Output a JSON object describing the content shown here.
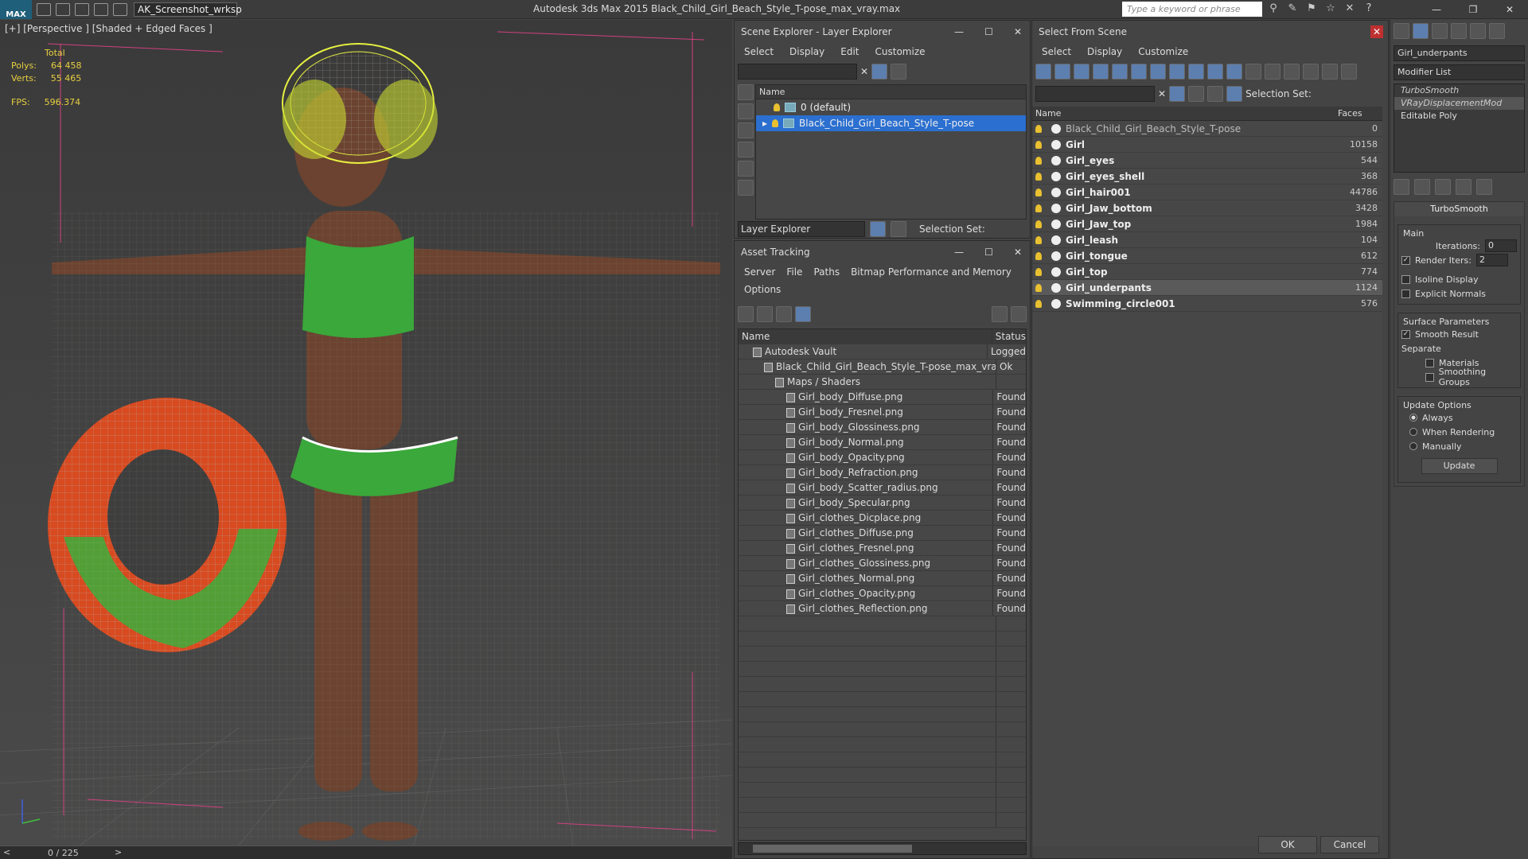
{
  "titlebar": {
    "logo": "MAX",
    "workspace": "AK_Screenshot_wrksp",
    "app_title": "Autodesk 3ds Max  2015    Black_Child_Girl_Beach_Style_T-pose_max_vray.max",
    "search_placeholder": "Type a keyword or phrase"
  },
  "viewport": {
    "label": "[+] [Perspective ] [Shaded + Edged Faces ]",
    "stats_total": "Total",
    "polys_label": "Polys:",
    "polys_value": "64 458",
    "verts_label": "Verts:",
    "verts_value": "55 465",
    "fps_label": "FPS:",
    "fps_value": "596.374"
  },
  "timeline": {
    "frame": "0 / 225"
  },
  "scene_explorer": {
    "title": "Scene Explorer - Layer Explorer",
    "menu": [
      "Select",
      "Display",
      "Edit",
      "Customize"
    ],
    "col_name": "Name",
    "layers": [
      "0 (default)",
      "Black_Child_Girl_Beach_Style_T-pose"
    ],
    "footer_label": "Layer Explorer",
    "selection_set": "Selection Set:"
  },
  "asset_tracking": {
    "title": "Asset Tracking",
    "menu": [
      "Server",
      "File",
      "Paths",
      "Bitmap Performance and Memory"
    ],
    "menu2": "Options",
    "col_name": "Name",
    "col_status": "Status",
    "rows": [
      {
        "name": "Autodesk Vault",
        "status": "Logged",
        "indent": 0
      },
      {
        "name": "Black_Child_Girl_Beach_Style_T-pose_max_vray....",
        "status": "Ok",
        "indent": 1
      },
      {
        "name": "Maps / Shaders",
        "status": "",
        "indent": 2
      },
      {
        "name": "Girl_body_Diffuse.png",
        "status": "Found",
        "indent": 3
      },
      {
        "name": "Girl_body_Fresnel.png",
        "status": "Found",
        "indent": 3
      },
      {
        "name": "Girl_body_Glossiness.png",
        "status": "Found",
        "indent": 3
      },
      {
        "name": "Girl_body_Normal.png",
        "status": "Found",
        "indent": 3
      },
      {
        "name": "Girl_body_Opacity.png",
        "status": "Found",
        "indent": 3
      },
      {
        "name": "Girl_body_Refraction.png",
        "status": "Found",
        "indent": 3
      },
      {
        "name": "Girl_body_Scatter_radius.png",
        "status": "Found",
        "indent": 3
      },
      {
        "name": "Girl_body_Specular.png",
        "status": "Found",
        "indent": 3
      },
      {
        "name": "Girl_clothes_Dicplace.png",
        "status": "Found",
        "indent": 3
      },
      {
        "name": "Girl_clothes_Diffuse.png",
        "status": "Found",
        "indent": 3
      },
      {
        "name": "Girl_clothes_Fresnel.png",
        "status": "Found",
        "indent": 3
      },
      {
        "name": "Girl_clothes_Glossiness.png",
        "status": "Found",
        "indent": 3
      },
      {
        "name": "Girl_clothes_Normal.png",
        "status": "Found",
        "indent": 3
      },
      {
        "name": "Girl_clothes_Opacity.png",
        "status": "Found",
        "indent": 3
      },
      {
        "name": "Girl_clothes_Reflection.png",
        "status": "Found",
        "indent": 3
      }
    ]
  },
  "select_from_scene": {
    "title": "Select From Scene",
    "menu": [
      "Select",
      "Display",
      "Customize"
    ],
    "selection_set": "Selection Set:",
    "col_name": "Name",
    "col_faces": "Faces",
    "rows": [
      {
        "name": "Black_Child_Girl_Beach_Style_T-pose",
        "faces": "0",
        "bold": false
      },
      {
        "name": "Girl",
        "faces": "10158",
        "bold": true
      },
      {
        "name": "Girl_eyes",
        "faces": "544",
        "bold": true
      },
      {
        "name": "Girl_eyes_shell",
        "faces": "368",
        "bold": true
      },
      {
        "name": "Girl_hair001",
        "faces": "44786",
        "bold": true
      },
      {
        "name": "Girl_Jaw_bottom",
        "faces": "3428",
        "bold": true
      },
      {
        "name": "Girl_Jaw_top",
        "faces": "1984",
        "bold": true
      },
      {
        "name": "Girl_leash",
        "faces": "104",
        "bold": true
      },
      {
        "name": "Girl_tongue",
        "faces": "612",
        "bold": true
      },
      {
        "name": "Girl_top",
        "faces": "774",
        "bold": true
      },
      {
        "name": "Girl_underpants",
        "faces": "1124",
        "bold": true
      },
      {
        "name": "Swimming_circle001",
        "faces": "576",
        "bold": true
      }
    ],
    "ok": "OK",
    "cancel": "Cancel"
  },
  "modifier": {
    "object_name": "Girl_underpants",
    "modifier_list": "Modifier List",
    "stack": [
      "TurboSmooth",
      "VRayDisplacementMod",
      "Editable Poly"
    ],
    "rollout": "TurboSmooth",
    "main": "Main",
    "iterations_label": "Iterations:",
    "iterations": "0",
    "render_iters_label": "Render Iters:",
    "render_iters": "2",
    "isoline": "Isoline Display",
    "explicit": "Explicit Normals",
    "surface": "Surface Parameters",
    "smooth_result": "Smooth Result",
    "separate": "Separate",
    "materials": "Materials",
    "smoothing_groups": "Smoothing Groups",
    "update_options": "Update Options",
    "always": "Always",
    "when_rendering": "When Rendering",
    "manually": "Manually",
    "update": "Update"
  }
}
